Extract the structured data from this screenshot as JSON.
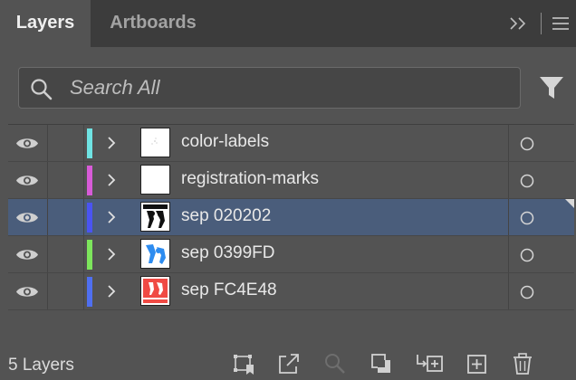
{
  "tabs": [
    {
      "label": "Layers",
      "active": true
    },
    {
      "label": "Artboards",
      "active": false
    }
  ],
  "tab_icons": [
    "collapse-panel-icon",
    "panel-menu-icon"
  ],
  "search": {
    "placeholder": "Search All",
    "value": ""
  },
  "layers": [
    {
      "name": "color-labels",
      "color": "#6fe3e3",
      "visible": true,
      "selected": false,
      "thumb": "blank-dots"
    },
    {
      "name": "registration-marks",
      "color": "#d85bd8",
      "visible": true,
      "selected": false,
      "thumb": "blank"
    },
    {
      "name": "sep 020202",
      "color": "#4a54f2",
      "visible": true,
      "selected": true,
      "thumb": "black-figures"
    },
    {
      "name": "sep 0399FD",
      "color": "#7de55c",
      "visible": true,
      "selected": false,
      "thumb": "blue-figures"
    },
    {
      "name": "sep FC4E48",
      "color": "#4f6ff0",
      "visible": true,
      "selected": false,
      "thumb": "red-figures"
    }
  ],
  "footer": {
    "count_label": "5 Layers",
    "buttons": [
      "collect-for-export-icon",
      "export-icon",
      "locate-object-icon",
      "make-clipping-mask-icon",
      "create-sublayer-icon",
      "create-new-layer-icon",
      "delete-layer-icon"
    ]
  },
  "colors": {
    "panel_bg": "#535353",
    "tab_bar_bg": "#3c3c3c",
    "selection": "#4a5d7b"
  }
}
